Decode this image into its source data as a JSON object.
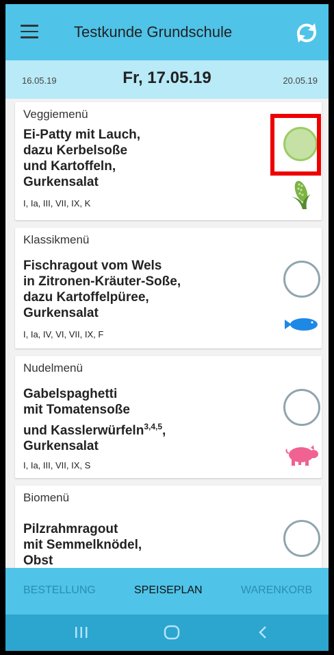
{
  "header": {
    "title": "Testkunde Grundschule",
    "menu_icon": "menu-icon",
    "sync_icon": "sync-icon"
  },
  "dates": {
    "prev": "16.05.19",
    "current": "Fr, 17.05.19",
    "next": "20.05.19"
  },
  "menus": [
    {
      "category": "Veggiemenü",
      "dish_lines": [
        "Ei-Patty mit Lauch,",
        "dazu Kerbelsoße",
        "und Kartoffeln,",
        "Gurkensalat"
      ],
      "allergens": "I, Ia, III, VII, IX, K",
      "selected": true,
      "icon": "corn-icon"
    },
    {
      "category": "Klassikmenü",
      "dish_lines": [
        "Fischragout vom Wels",
        "in Zitronen-Kräuter-Soße,",
        "dazu Kartoffelpüree,",
        "Gurkensalat"
      ],
      "allergens": "I, Ia, IV, VI, VII, IX, F",
      "selected": false,
      "icon": "fish-icon"
    },
    {
      "category": "Nudelmenü",
      "dish_lines": [
        "Gabelspaghetti",
        "mit Tomatensoße",
        "und Kasslerwürfeln",
        "Gurkensalat"
      ],
      "dish_superscript": "3,4,5",
      "dish_after_superscript": ",",
      "allergens": "I, Ia, III, VII, IX, S",
      "selected": false,
      "icon": "pig-icon"
    },
    {
      "category": "Biomenü",
      "dish_lines": [
        "Pilzrahmragout",
        "mit Semmelknödel,",
        "Obst"
      ],
      "selected": false
    }
  ],
  "bottom_nav": {
    "tabs": [
      "BESTELLUNG",
      "SPEISEPLAN",
      "WARENKORB"
    ],
    "active": "SPEISEPLAN"
  },
  "colors": {
    "primary": "#4fc3e8",
    "date_bar": "#b8eaf7",
    "selected_fill": "#c5e1a5",
    "highlight": "#ee0000"
  }
}
